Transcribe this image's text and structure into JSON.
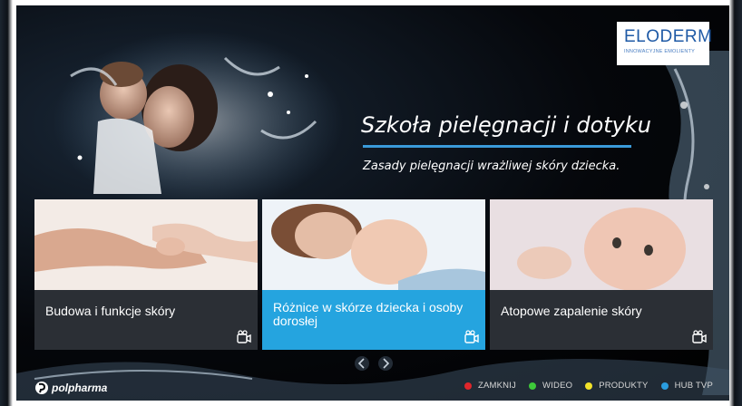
{
  "logo": {
    "title": "ELODERM",
    "subtitle": "INNOWACYJNE EMOLIENTY"
  },
  "hero": {
    "title": "Szkoła pielęgnacji i dotyku",
    "subtitle": "Zasady pielęgnacji wrażliwej skóry dziecka.",
    "accent_color": "#3a9ad9"
  },
  "tiles": [
    {
      "label": "Budowa i funkcje skóry",
      "icon": "video-camera-icon",
      "active": false
    },
    {
      "label": "Różnice w skórze dziecka i osoby dorosłej",
      "icon": "video-camera-icon",
      "active": true
    },
    {
      "label": "Atopowe zapalenie skóry",
      "icon": "video-camera-icon",
      "active": false
    }
  ],
  "brand": {
    "name": "polpharma"
  },
  "legend": [
    {
      "label": "ZAMKNIJ",
      "color": "#e0262b"
    },
    {
      "label": "WIDEO",
      "color": "#3ec93a"
    },
    {
      "label": "PRODUKTY",
      "color": "#f2e32a"
    },
    {
      "label": "HUB TVP",
      "color": "#2a9de0"
    }
  ]
}
